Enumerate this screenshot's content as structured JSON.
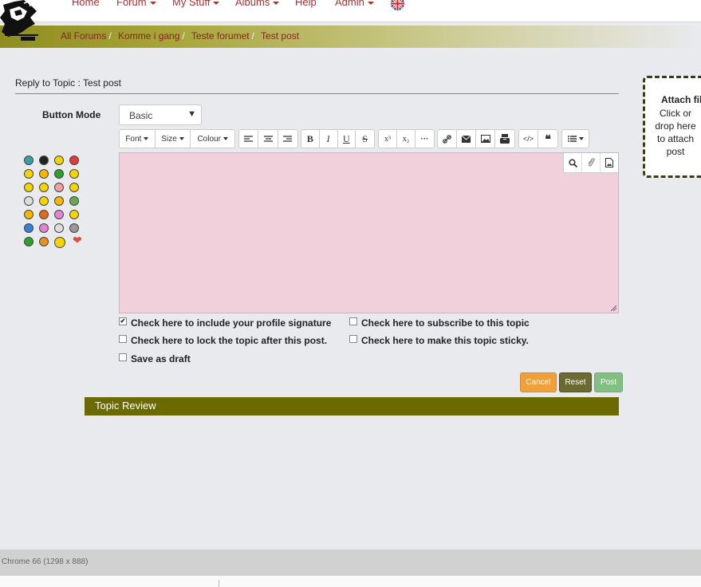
{
  "nav": {
    "items": [
      {
        "label": "Home",
        "dropdown": false
      },
      {
        "label": "Forum",
        "dropdown": true
      },
      {
        "label": "My Stuff",
        "dropdown": true
      },
      {
        "label": "Albums",
        "dropdown": true
      },
      {
        "label": "Help",
        "dropdown": false
      },
      {
        "label": "Admin",
        "dropdown": true
      }
    ],
    "language_icon": "uk-flag-icon",
    "logo_icon": "site-logo-icon"
  },
  "breadcrumb": [
    "All Forums",
    "Komme i gang",
    "Teste forumet",
    "Test post"
  ],
  "reply": {
    "title": "Reply to Topic : Test post",
    "button_mode_label": "Button Mode",
    "button_mode_value": "Basic"
  },
  "attach": {
    "title": "Attach fil",
    "text": "Click or drop here to attach post"
  },
  "toolbar": {
    "font": "Font",
    "size": "Size",
    "colour": "Colour",
    "bold": "B",
    "italic": "I",
    "underline": "U",
    "strike": "S",
    "superscript": "x³",
    "subscript": "x₂",
    "more": "···"
  },
  "options": {
    "signature": "Check here to include your profile signature",
    "subscribe": "Check here to subscribe to this topic",
    "lock": "Check here to lock the topic after this post.",
    "sticky": "Check here to make this topic sticky.",
    "draft": "Save as draft",
    "signature_checked": true
  },
  "buttons": {
    "cancel": "Cancel",
    "reset": "Reset",
    "post": "Post"
  },
  "review": {
    "title": "Topic Review"
  },
  "status": {
    "text": "Chrome 66 (1298 x 888)"
  },
  "colors": {
    "nav_link": "#a3332f",
    "breadcrumb_bar": "#8f8d1f",
    "editor_bg": "#f2d0db",
    "review_header": "#6b6a00",
    "cancel_btn": "#f0a03a",
    "reset_btn": "#6b6a33",
    "post_btn": "#82bf83"
  }
}
